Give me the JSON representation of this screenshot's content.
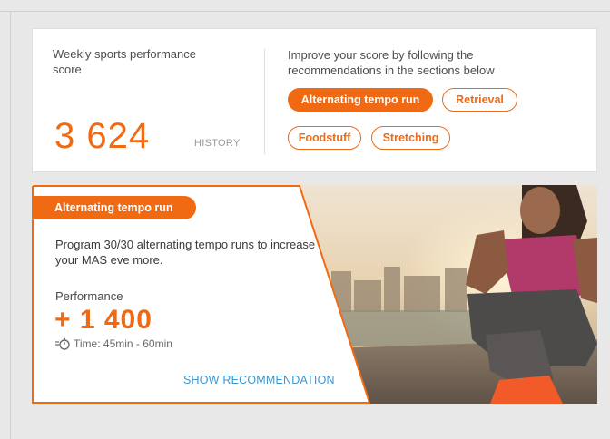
{
  "score_card": {
    "title": "Weekly sports performance score",
    "score": "3 624",
    "history_label": "HISTORY",
    "improve_text": "Improve your score by following the recommendations in the sections below",
    "chips": [
      {
        "label": "Alternating tempo run",
        "active": true
      },
      {
        "label": "Retrieval",
        "active": false
      },
      {
        "label": "Foodstuff",
        "active": false
      },
      {
        "label": "Stretching",
        "active": false
      }
    ]
  },
  "recommendation": {
    "badge": "Alternating tempo run",
    "description": "Program 30/30 alternating tempo runs to increase your MAS eve more.",
    "performance_label": "Performance",
    "performance_value": "+ 1 400",
    "time_label": "Time: 45min - 60min",
    "show_label": "SHOW RECOMMENDATION",
    "timer_icon": "stopwatch-icon"
  },
  "colors": {
    "accent": "#f06a14",
    "link": "#3a97d0",
    "background": "#e8e8e8"
  }
}
